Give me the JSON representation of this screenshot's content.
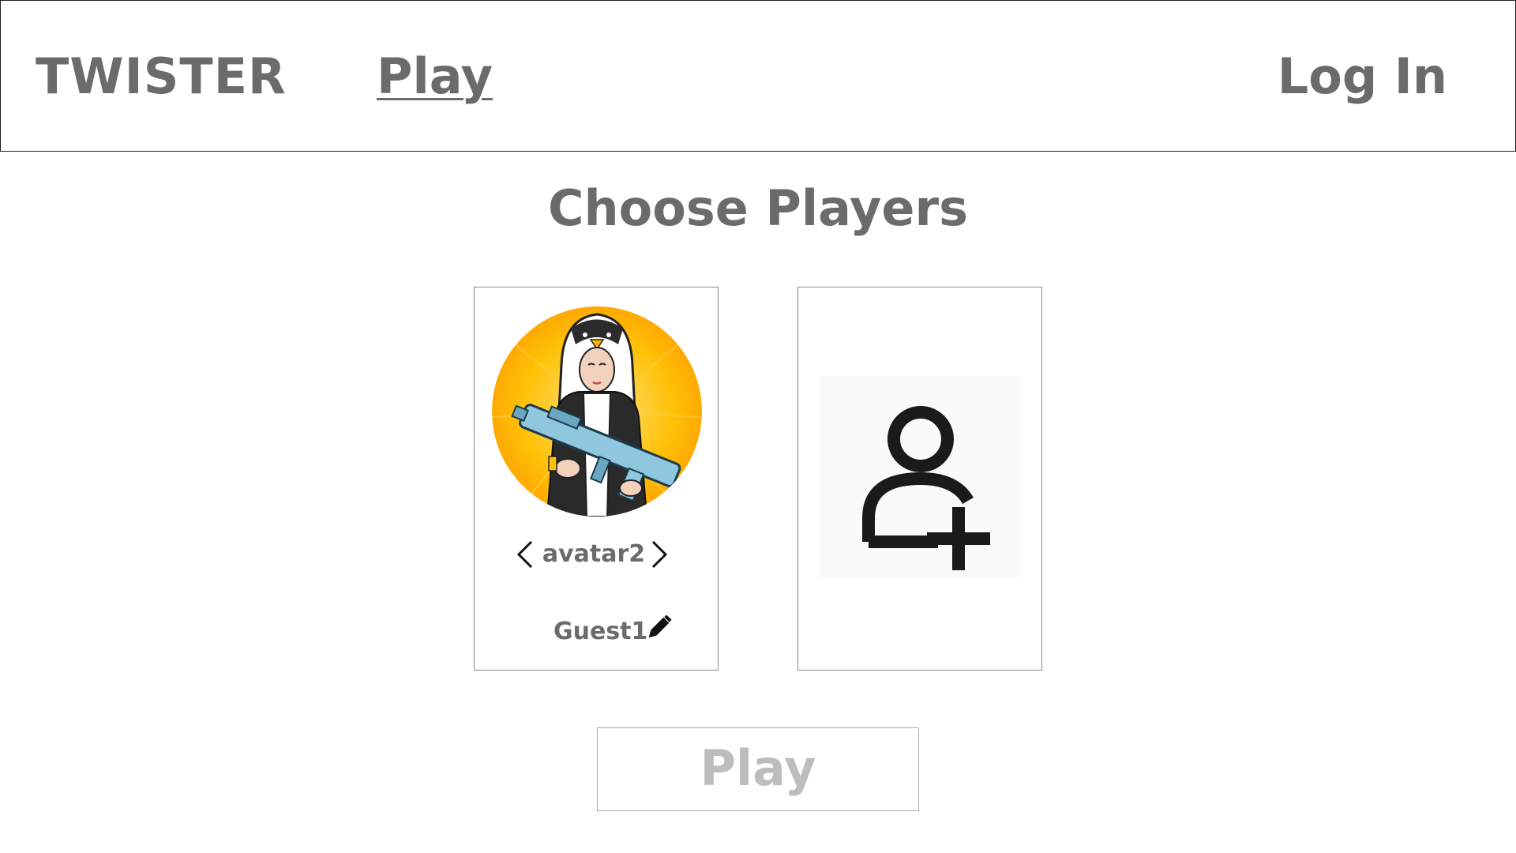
{
  "header": {
    "brand": "TWISTER",
    "nav_play": "Play",
    "login": "Log In"
  },
  "title": "Choose Players",
  "player_card": {
    "avatar_name": "avatar2",
    "guest_name": "Guest1",
    "prev_icon": "chevron-left-icon",
    "next_icon": "chevron-right-icon",
    "edit_icon": "pencil-icon"
  },
  "add_player_card": {
    "icon": "add-user-icon"
  },
  "play_button": {
    "label": "Play"
  },
  "colors": {
    "text": "#6b6b6b",
    "disabled_text": "#bdbdbd",
    "avatar_bg": "#ffb300",
    "icon": "#1a1a1a"
  }
}
